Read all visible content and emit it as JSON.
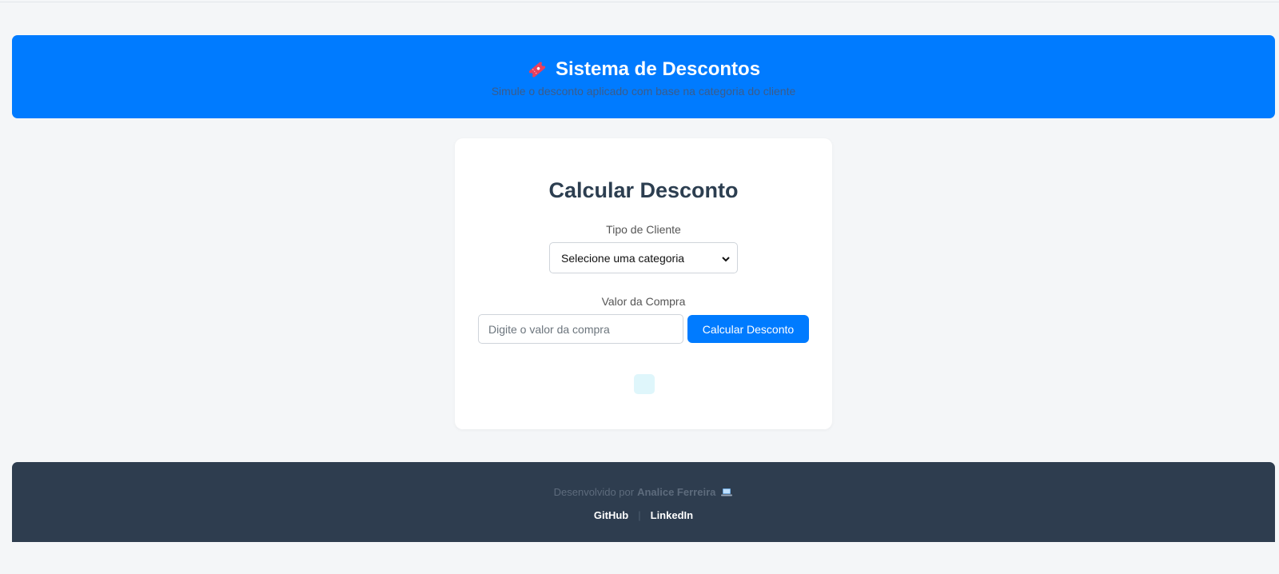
{
  "header": {
    "title": "Sistema de Descontos",
    "subtitle": "Simule o desconto aplicado com base na categoria do cliente",
    "icon": "ticket-icon"
  },
  "card": {
    "title": "Calcular Desconto",
    "client_type_label": "Tipo de Cliente",
    "client_type_select": {
      "selected": "Selecione uma categoria"
    },
    "purchase_value_label": "Valor da Compra",
    "purchase_value_input": {
      "value": "",
      "placeholder": "Digite o valor da compra"
    },
    "calculate_button_label": "Calcular Desconto"
  },
  "footer": {
    "credit_prefix": "Desenvolvido por",
    "author": "Analice Ferreira",
    "icon": "laptop-icon",
    "links": {
      "github": "GitHub",
      "linkedin": "LinkedIn",
      "separator": "|"
    }
  },
  "colors": {
    "primary": "#007bff",
    "footer_bg": "#2e3d4f",
    "page_bg": "#f4f6f8",
    "heading": "#2c3e50",
    "result_bg": "#dff6fb"
  }
}
